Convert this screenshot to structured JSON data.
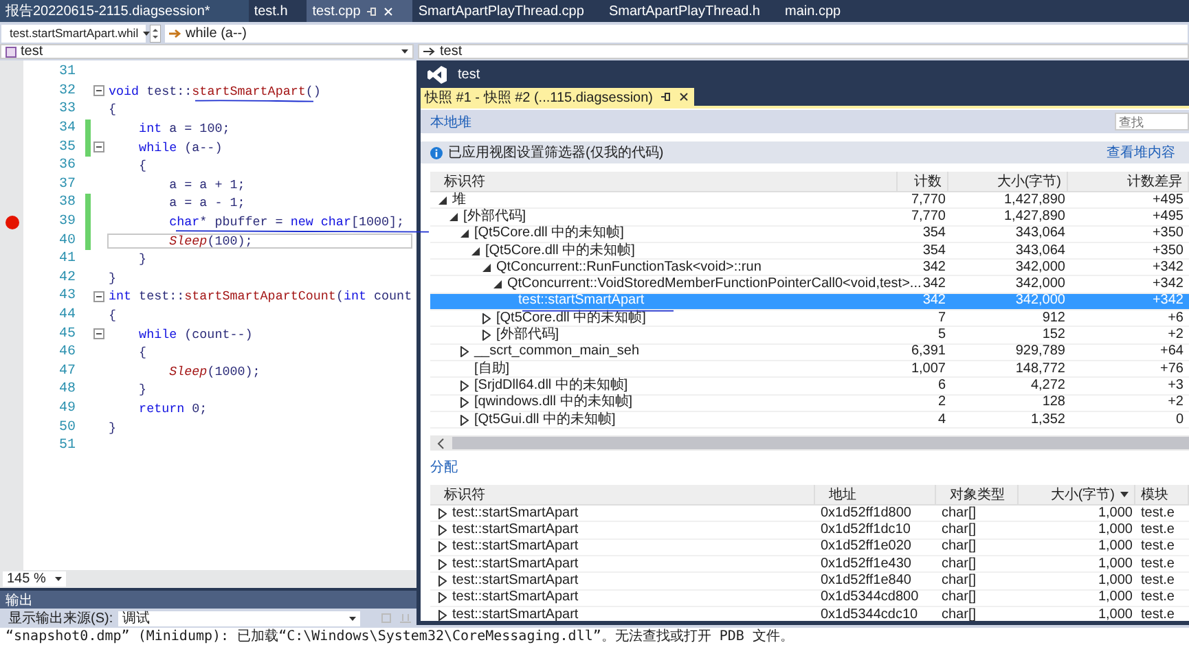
{
  "doc_tabs": [
    {
      "label": "报告20220615-2115.diagsession*",
      "selected": false
    },
    {
      "label": "test.h",
      "selected": false
    },
    {
      "label": "test.cpp",
      "selected": true
    },
    {
      "label": "SmartApartPlayThread.cpp",
      "selected": false
    },
    {
      "label": "SmartApartPlayThread.h",
      "selected": false
    },
    {
      "label": "main.cpp",
      "selected": false
    }
  ],
  "nav": {
    "scope": "test.startSmartApart.whil",
    "member": "while (a--)",
    "project": "test",
    "project_right": "test"
  },
  "code_lines": [
    {
      "number": "31",
      "breakpoint": false,
      "changed": false,
      "collapsible": false,
      "current": false
    },
    {
      "number": "32",
      "breakpoint": false,
      "changed": false,
      "collapsible": true,
      "current": false,
      "tokens": [
        {
          "kind": "keyword",
          "text": "void"
        },
        {
          "kind": "plain",
          "text": " test::"
        },
        {
          "kind": "function",
          "text": "startSmartApart"
        },
        {
          "kind": "plain",
          "text": "()"
        }
      ]
    },
    {
      "number": "33",
      "breakpoint": false,
      "changed": false,
      "collapsible": false,
      "current": false,
      "tokens": [
        {
          "kind": "plain",
          "text": "{"
        }
      ]
    },
    {
      "number": "34",
      "breakpoint": false,
      "changed": true,
      "collapsible": false,
      "current": false,
      "tokens": [
        {
          "kind": "keyword",
          "text": "    int"
        },
        {
          "kind": "plain",
          "text": " a = 100;"
        }
      ]
    },
    {
      "number": "35",
      "breakpoint": false,
      "changed": true,
      "collapsible": true,
      "current": false,
      "tokens": [
        {
          "kind": "keyword",
          "text": "    while"
        },
        {
          "kind": "plain",
          "text": " (a--)"
        }
      ]
    },
    {
      "number": "36",
      "breakpoint": false,
      "changed": false,
      "collapsible": false,
      "current": false,
      "tokens": [
        {
          "kind": "plain",
          "text": "    {"
        }
      ]
    },
    {
      "number": "37",
      "breakpoint": false,
      "changed": false,
      "collapsible": false,
      "current": false,
      "tokens": [
        {
          "kind": "plain",
          "text": "        a = a + 1;"
        }
      ]
    },
    {
      "number": "38",
      "breakpoint": false,
      "changed": true,
      "collapsible": false,
      "current": false,
      "tokens": [
        {
          "kind": "plain",
          "text": "        a = a - 1;"
        }
      ]
    },
    {
      "number": "39",
      "breakpoint": true,
      "changed": true,
      "collapsible": false,
      "current": false,
      "tokens": [
        {
          "kind": "keyword",
          "text": "        char"
        },
        {
          "kind": "plain",
          "text": "* pbuffer = "
        },
        {
          "kind": "keyword",
          "text": "new char"
        },
        {
          "kind": "plain",
          "text": "[1000];"
        }
      ]
    },
    {
      "number": "40",
      "breakpoint": false,
      "changed": true,
      "collapsible": false,
      "current": true,
      "tokens": [
        {
          "kind": "call",
          "text": "        Sleep"
        },
        {
          "kind": "plain",
          "text": "(100);"
        }
      ]
    },
    {
      "number": "41",
      "breakpoint": false,
      "changed": false,
      "collapsible": false,
      "current": false,
      "tokens": [
        {
          "kind": "plain",
          "text": "    }"
        }
      ]
    },
    {
      "number": "42",
      "breakpoint": false,
      "changed": false,
      "collapsible": false,
      "current": false,
      "tokens": [
        {
          "kind": "plain",
          "text": "}"
        }
      ]
    },
    {
      "number": "43",
      "breakpoint": false,
      "changed": false,
      "collapsible": true,
      "current": false,
      "tokens": [
        {
          "kind": "keyword",
          "text": "int"
        },
        {
          "kind": "plain",
          "text": " test::"
        },
        {
          "kind": "function",
          "text": "startSmartApartCount"
        },
        {
          "kind": "plain",
          "text": "("
        },
        {
          "kind": "keyword",
          "text": "int"
        },
        {
          "kind": "plain",
          "text": " count"
        }
      ]
    },
    {
      "number": "44",
      "breakpoint": false,
      "changed": false,
      "collapsible": false,
      "current": false,
      "tokens": [
        {
          "kind": "plain",
          "text": "{"
        }
      ]
    },
    {
      "number": "45",
      "breakpoint": false,
      "changed": false,
      "collapsible": true,
      "current": false,
      "tokens": [
        {
          "kind": "keyword",
          "text": "    while"
        },
        {
          "kind": "plain",
          "text": " (count--)"
        }
      ]
    },
    {
      "number": "46",
      "breakpoint": false,
      "changed": false,
      "collapsible": false,
      "current": false,
      "tokens": [
        {
          "kind": "plain",
          "text": "    {"
        }
      ]
    },
    {
      "number": "47",
      "breakpoint": false,
      "changed": false,
      "collapsible": false,
      "current": false,
      "tokens": [
        {
          "kind": "call",
          "text": "        Sleep"
        },
        {
          "kind": "plain",
          "text": "(1000);"
        }
      ]
    },
    {
      "number": "48",
      "breakpoint": false,
      "changed": false,
      "collapsible": false,
      "current": false,
      "tokens": [
        {
          "kind": "plain",
          "text": "    }"
        }
      ]
    },
    {
      "number": "49",
      "breakpoint": false,
      "changed": false,
      "collapsible": false,
      "current": false,
      "tokens": [
        {
          "kind": "keyword",
          "text": "    return"
        },
        {
          "kind": "plain",
          "text": " 0;"
        }
      ]
    },
    {
      "number": "50",
      "breakpoint": false,
      "changed": false,
      "collapsible": false,
      "current": false,
      "tokens": [
        {
          "kind": "plain",
          "text": "}"
        }
      ]
    },
    {
      "number": "51",
      "breakpoint": false,
      "changed": false,
      "collapsible": false,
      "current": false
    }
  ],
  "zoom": "145 %",
  "output": {
    "title": "输出",
    "source_label": "显示输出来源(S):",
    "source": "调试",
    "line": "“snapshot0.dmp” (Minidump): 已加载“C:\\Windows\\System32\\CoreMessaging.dll”。无法查找或打开 PDB 文件。"
  },
  "window": {
    "title": "test",
    "tab": "快照 #1 - 快照 #2 (...115.diagsession)",
    "section": "本地堆",
    "search": {
      "placeholder": "查找"
    },
    "info": "已应用视图设置筛选器(仅我的代码)",
    "info_link": "查看堆内容",
    "heap_table": {
      "columns": [
        "标识符",
        "计数",
        "大小(字节)",
        "计数差异"
      ],
      "rows": [
        {
          "label": "堆",
          "count": "7,770",
          "size": "1,427,890",
          "count_diff": "+495",
          "expandable": true,
          "expanded": true,
          "selected": false,
          "children": [
            {
              "label": "[外部代码]",
              "count": "7,770",
              "size": "1,427,890",
              "count_diff": "+495",
              "expandable": true,
              "expanded": true,
              "selected": false,
              "children": [
                {
                  "label": "[Qt5Core.dll 中的未知帧]",
                  "count": "354",
                  "size": "343,064",
                  "count_diff": "+350",
                  "expandable": true,
                  "expanded": true,
                  "selected": false,
                  "children": [
                    {
                      "label": "[Qt5Core.dll 中的未知帧]",
                      "count": "354",
                      "size": "343,064",
                      "count_diff": "+350",
                      "expandable": true,
                      "expanded": true,
                      "selected": false,
                      "children": [
                        {
                          "label": "QtConcurrent::RunFunctionTask<void>::run",
                          "count": "342",
                          "size": "342,000",
                          "count_diff": "+342",
                          "expandable": true,
                          "expanded": true,
                          "selected": false,
                          "children": [
                            {
                              "label": "QtConcurrent::VoidStoredMemberFunctionPointerCall0<void,test>...",
                              "count": "342",
                              "size": "342,000",
                              "count_diff": "+342",
                              "expandable": true,
                              "expanded": true,
                              "selected": false,
                              "children": [
                                {
                                  "label": "test::startSmartApart",
                                  "count": "342",
                                  "size": "342,000",
                                  "count_diff": "+342",
                                  "expandable": false,
                                  "expanded": false,
                                  "selected": true
                                }
                              ]
                            }
                          ]
                        },
                        {
                          "label": "[Qt5Core.dll 中的未知帧]",
                          "count": "7",
                          "size": "912",
                          "count_diff": "+6",
                          "expandable": true,
                          "expanded": false,
                          "selected": false
                        },
                        {
                          "label": "[外部代码]",
                          "count": "5",
                          "size": "152",
                          "count_diff": "+2",
                          "expandable": true,
                          "expanded": false,
                          "selected": false
                        }
                      ]
                    }
                  ]
                },
                {
                  "label": "__scrt_common_main_seh",
                  "count": "6,391",
                  "size": "929,789",
                  "count_diff": "+64",
                  "expandable": true,
                  "expanded": false,
                  "selected": false
                },
                {
                  "label": "[自助]",
                  "count": "1,007",
                  "size": "148,772",
                  "count_diff": "+76",
                  "expandable": false,
                  "expanded": false,
                  "selected": false
                },
                {
                  "label": "[SrjdDll64.dll 中的未知帧]",
                  "count": "6",
                  "size": "4,272",
                  "count_diff": "+3",
                  "expandable": true,
                  "expanded": false,
                  "selected": false
                },
                {
                  "label": "[qwindows.dll 中的未知帧]",
                  "count": "2",
                  "size": "128",
                  "count_diff": "+2",
                  "expandable": true,
                  "expanded": false,
                  "selected": false
                },
                {
                  "label": "[Qt5Gui.dll 中的未知帧]",
                  "count": "4",
                  "size": "1,352",
                  "count_diff": "0",
                  "expandable": true,
                  "expanded": false,
                  "selected": false
                }
              ]
            }
          ]
        }
      ]
    },
    "alloc_title": "分配",
    "alloc_table": {
      "columns": [
        {
          "label": "标识符",
          "sorted": false
        },
        {
          "label": "地址",
          "sorted": false
        },
        {
          "label": "对象类型",
          "sorted": false
        },
        {
          "label": "大小(字节)",
          "sorted": true
        },
        {
          "label": "模块",
          "sorted": false
        }
      ],
      "rows": [
        {
          "id": "test::startSmartApart",
          "address": "0x1d52ff1d800",
          "type": "char[]",
          "size": "1,000",
          "module": "test.e"
        },
        {
          "id": "test::startSmartApart",
          "address": "0x1d52ff1dc10",
          "type": "char[]",
          "size": "1,000",
          "module": "test.e"
        },
        {
          "id": "test::startSmartApart",
          "address": "0x1d52ff1e020",
          "type": "char[]",
          "size": "1,000",
          "module": "test.e"
        },
        {
          "id": "test::startSmartApart",
          "address": "0x1d52ff1e430",
          "type": "char[]",
          "size": "1,000",
          "module": "test.e"
        },
        {
          "id": "test::startSmartApart",
          "address": "0x1d52ff1e840",
          "type": "char[]",
          "size": "1,000",
          "module": "test.e"
        },
        {
          "id": "test::startSmartApart",
          "address": "0x1d5344cd800",
          "type": "char[]",
          "size": "1,000",
          "module": "test.e"
        },
        {
          "id": "test::startSmartApart",
          "address": "0x1d5344cdc10",
          "type": "char[]",
          "size": "1,000",
          "module": "test.e"
        }
      ]
    }
  }
}
